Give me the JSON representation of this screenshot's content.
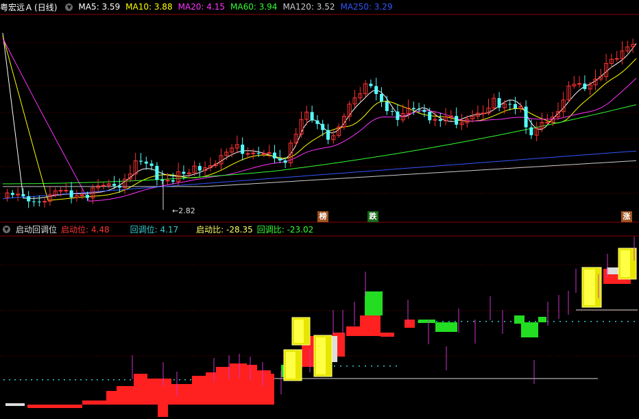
{
  "main_header": {
    "stock_name": "粤宏远Ａ",
    "period": "(日线)",
    "ma": [
      {
        "label": "MA5: 3.59",
        "color": "#ffffff"
      },
      {
        "label": "MA10: 3.88",
        "color": "#ffff00"
      },
      {
        "label": "MA20: 4.15",
        "color": "#ff33ff"
      },
      {
        "label": "MA60: 3.94",
        "color": "#33ff33"
      },
      {
        "label": "MA120: 3.52",
        "color": "#cccccc"
      },
      {
        "label": "MA250: 3.29",
        "color": "#3355ff"
      }
    ]
  },
  "low_marker": "←2.82",
  "signals": {
    "s1": "榜",
    "s2": "跌",
    "s3": "涨"
  },
  "sub_header": {
    "indicator_name": "启动回调位",
    "items": [
      {
        "label": "启动位: 4.48",
        "color": "#ff3333"
      },
      {
        "label": "回调位: 4.17",
        "color": "#33cccc"
      },
      {
        "label": "启动比: -28.35",
        "color": "#ffff66"
      },
      {
        "label": "回调比: -23.02",
        "color": "#33ff33"
      }
    ]
  },
  "colors": {
    "up": "#ff3333",
    "down": "#54ffff",
    "grid": "#7a0000",
    "separator": "#8b0000",
    "bg": "#000000"
  }
}
